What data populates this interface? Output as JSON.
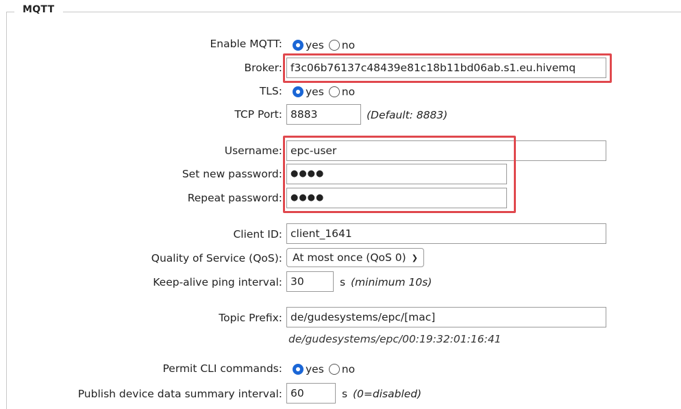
{
  "legend": "MQTT",
  "options": {
    "yes": "yes",
    "no": "no"
  },
  "enable_mqtt": {
    "label": "Enable MQTT",
    "value": "yes"
  },
  "broker": {
    "label": "Broker",
    "value": "f3c06b76137c48439e81c18b11bd06ab.s1.eu.hivemq"
  },
  "tls": {
    "label": "TLS",
    "value": "yes"
  },
  "tcp_port": {
    "label": "TCP Port",
    "value": "8883",
    "hint": "(Default: 8883)"
  },
  "username": {
    "label": "Username",
    "value": "epc-user"
  },
  "new_password": {
    "label": "Set new password",
    "value": "●●●●"
  },
  "repeat_password": {
    "label": "Repeat password",
    "value": "●●●●"
  },
  "client_id": {
    "label": "Client ID",
    "value": "client_1641"
  },
  "qos": {
    "label": "Quality of Service (QoS)",
    "value": "At most once (QoS 0)"
  },
  "keepalive": {
    "label": "Keep-alive ping interval",
    "value": "30",
    "unit": "s",
    "hint": "(minimum 10s)"
  },
  "topic_prefix": {
    "label": "Topic Prefix",
    "value": "de/gudesystems/epc/[mac]",
    "preview": "de/gudesystems/epc/00:19:32:01:16:41"
  },
  "permit_cli": {
    "label": "Permit CLI commands",
    "value": "yes"
  },
  "publish_summary": {
    "label": "Publish device data summary interval",
    "value": "60",
    "unit": "s",
    "hint": "(0=disabled)"
  },
  "colors": {
    "radio_checked": "#1a66d6",
    "highlight": "#e0484d"
  }
}
